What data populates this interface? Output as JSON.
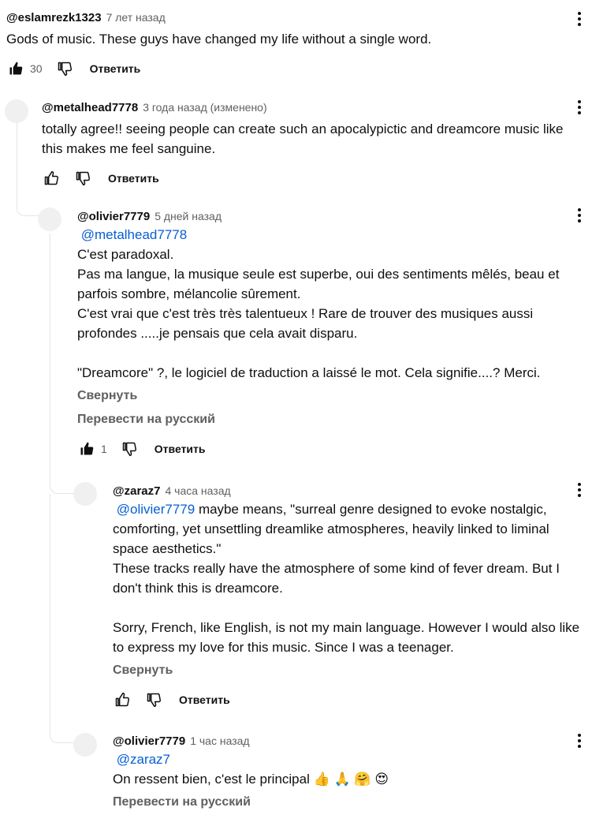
{
  "comments": [
    {
      "author": "@eslamrezk1323",
      "time": "7 лет назад",
      "lines": [
        "Gods of music. These guys have changed my life without a single word."
      ],
      "likes": "30",
      "reply": "Ответить"
    },
    {
      "author": "@metalhead7778",
      "time": "3 года назад (изменено)",
      "lines": [
        "totally agree!! seeing people can create such an apocalypictic and dreamcore music like",
        "this makes me feel sanguine."
      ],
      "reply": "Ответить"
    },
    {
      "author": "@olivier7779",
      "time": "5 дней назад",
      "mention": "@metalhead7778",
      "lines": [
        "C'est paradoxal.",
        "Pas ma langue, la musique seule est superbe, oui des sentiments mêlés, beau et",
        "parfois sombre, mélancolie sûrement.",
        "C'est vrai que c'est très très  talentueux ! Rare de trouver des musiques aussi",
        "profondes .....je pensais que cela avait disparu.",
        "\"Dreamcore\" ?, le logiciel de traduction a laissé le mot. Cela signifie....? Merci."
      ],
      "collapse": "Свернуть",
      "translate": "Перевести на русский",
      "likes": "1",
      "reply": "Ответить"
    },
    {
      "author": "@zaraz7",
      "time": "4 часа назад",
      "mention": "@olivier7779",
      "lines": [
        " maybe means, \"surreal genre designed to evoke nostalgic,",
        "comforting, yet unsettling dreamlike atmospheres, heavily linked to liminal",
        "space aesthetics.\"",
        "These tracks really have the atmosphere of some kind of fever dream. But I",
        "don't think this is dreamcore.",
        "Sorry, French, like English, is not my main language. However I would also like",
        "to express my love for this music. Since I was a teenager."
      ],
      "collapse": "Свернуть",
      "reply": "Ответить"
    },
    {
      "author": "@olivier7779",
      "time": "1 час назад",
      "mention": "@zaraz7",
      "lines": [
        "On ressent bien, c'est le principal "
      ],
      "emojis": [
        "👍",
        "🙏",
        "🤗",
        "😍"
      ],
      "translate": "Перевести на русский"
    }
  ],
  "icons": {
    "like_filled": "thumbs-up-filled-icon",
    "like_outline": "thumbs-up-outline-icon",
    "dislike": "thumbs-down-outline-icon",
    "menu": "more-vertical-icon"
  }
}
